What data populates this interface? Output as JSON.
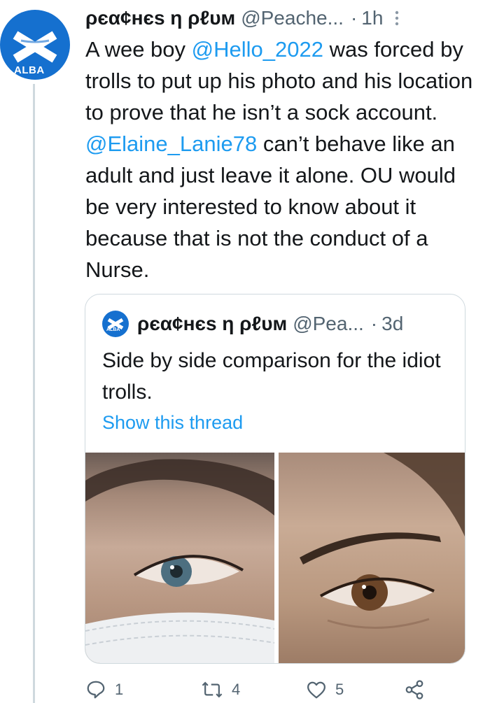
{
  "tweet": {
    "avatar_text": "ALBA",
    "name": "ρєα¢нєѕ η ρℓυм",
    "handle": "@Peache...",
    "dot": "·",
    "time": "1h",
    "text_parts": [
      "A wee boy ",
      "@Hello_2022",
      " was forced by trolls to put up his photo and his location to prove that he isn’t a sock account. ",
      "@Elaine_Lanie78",
      " can’t behave like an adult and just leave it alone. OU would be very interested to know about it because that is not the conduct of a Nurse."
    ]
  },
  "quote": {
    "avatar_text": "ALBA",
    "name": "ρєα¢нєѕ η ρℓυм",
    "handle": "@Pea...",
    "dot": "·",
    "time": "3d",
    "text": "Side by side comparison for the idiot trolls.",
    "link": "Show this thread"
  },
  "actions": {
    "reply_count": "1",
    "retweet_count": "4",
    "like_count": "5"
  },
  "colors": {
    "accent": "#1d9bf0",
    "alba_blue": "#1570cf",
    "muted": "#536471",
    "border": "#cfd9de"
  },
  "icons": [
    "reply-icon",
    "retweet-icon",
    "like-icon",
    "share-icon",
    "more-icon"
  ]
}
